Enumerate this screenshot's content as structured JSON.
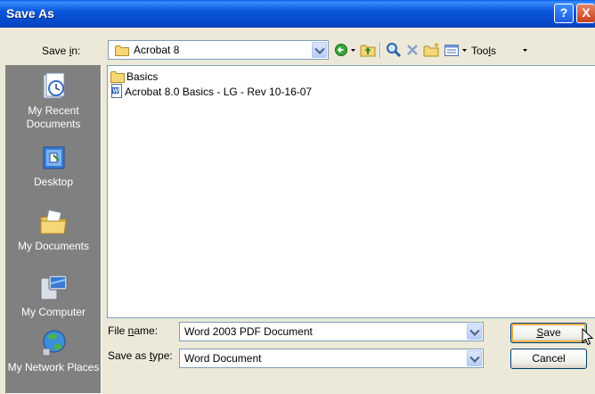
{
  "window": {
    "title": "Save As",
    "help_label": "?",
    "close_label": "X"
  },
  "toolbar": {
    "save_in_label_pre": "Save ",
    "save_in_label_key": "i",
    "save_in_label_post": "n:",
    "current_folder": "Acrobat 8",
    "tools_label_pre": "Too",
    "tools_label_key": "l",
    "tools_label_post": "s"
  },
  "places": [
    {
      "label": "My Recent Documents",
      "icon": "recent-documents-icon"
    },
    {
      "label": "Desktop",
      "icon": "desktop-icon"
    },
    {
      "label": "My Documents",
      "icon": "my-documents-icon"
    },
    {
      "label": "My Computer",
      "icon": "my-computer-icon"
    },
    {
      "label": "My Network Places",
      "icon": "network-places-icon"
    }
  ],
  "files": [
    {
      "name": "Basics",
      "type": "folder"
    },
    {
      "name": "Acrobat 8.0 Basics - LG - Rev 10-16-07",
      "type": "word-document"
    }
  ],
  "form": {
    "file_name_label_pre": "File ",
    "file_name_label_key": "n",
    "file_name_label_post": "ame:",
    "file_name_value": "Word 2003 PDF Document",
    "save_type_label_pre": "Save as ",
    "save_type_label_key": "t",
    "save_type_label_post": "ype:",
    "save_type_value": "Word Document"
  },
  "buttons": {
    "save_key": "S",
    "save_rest": "ave",
    "cancel": "Cancel"
  },
  "colors": {
    "titlebar": "#0A58D8",
    "dialog_bg": "#ECE9D8",
    "places_bg": "#808080"
  }
}
